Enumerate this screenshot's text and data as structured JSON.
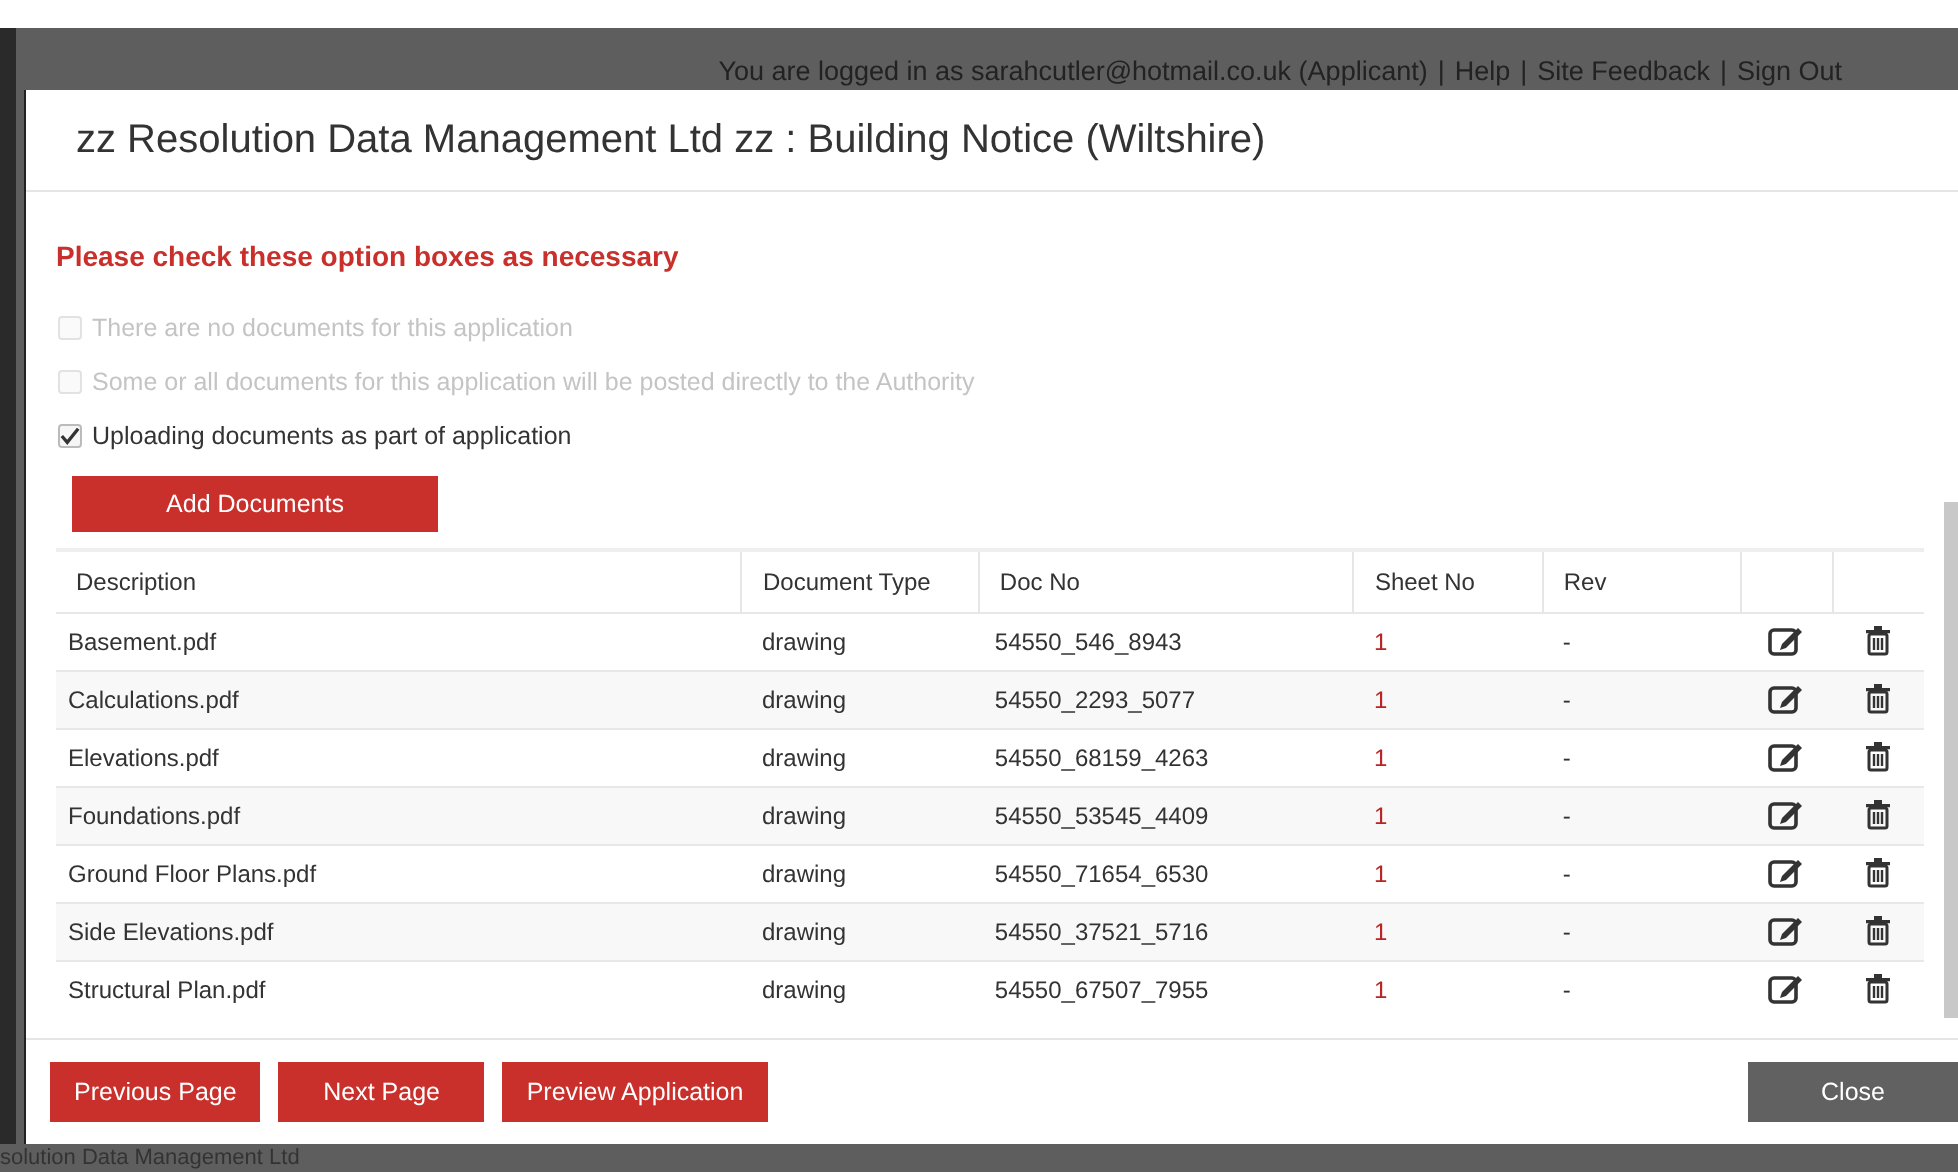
{
  "top_bar": {
    "login_text": "You are logged in as sarahcutler@hotmail.co.uk (Applicant)",
    "links": [
      {
        "separator": "|",
        "label": "Help"
      },
      {
        "separator": "|",
        "label": "Site Feedback"
      },
      {
        "separator": "|",
        "label": "Sign Out"
      }
    ]
  },
  "dialog": {
    "title": "zz Resolution Data Management Ltd zz : Building Notice (Wiltshire)",
    "heading": "Please check these option boxes as necessary",
    "options": [
      {
        "label": "There are no documents for this application",
        "checked": false,
        "disabled": true
      },
      {
        "label": "Some or all documents for this application will be posted directly to the Authority",
        "checked": false,
        "disabled": true
      },
      {
        "label": "Uploading documents as part of application",
        "checked": true,
        "disabled": false
      }
    ],
    "add_button": "Add Documents",
    "table": {
      "columns": [
        "Description",
        "Document Type",
        "Doc No",
        "Sheet No",
        "Rev"
      ],
      "rows": [
        {
          "description": "Basement.pdf",
          "document_type": "drawing",
          "doc_no": "54550_546_8943",
          "sheet_no": "1",
          "rev": "-"
        },
        {
          "description": "Calculations.pdf",
          "document_type": "drawing",
          "doc_no": "54550_2293_5077",
          "sheet_no": "1",
          "rev": "-"
        },
        {
          "description": "Elevations.pdf",
          "document_type": "drawing",
          "doc_no": "54550_68159_4263",
          "sheet_no": "1",
          "rev": "-"
        },
        {
          "description": "Foundations.pdf",
          "document_type": "drawing",
          "doc_no": "54550_53545_4409",
          "sheet_no": "1",
          "rev": "-"
        },
        {
          "description": "Ground Floor Plans.pdf",
          "document_type": "drawing",
          "doc_no": "54550_71654_6530",
          "sheet_no": "1",
          "rev": "-"
        },
        {
          "description": "Side Elevations.pdf",
          "document_type": "drawing",
          "doc_no": "54550_37521_5716",
          "sheet_no": "1",
          "rev": "-"
        },
        {
          "description": "Structural Plan.pdf",
          "document_type": "drawing",
          "doc_no": "54550_67507_7955",
          "sheet_no": "1",
          "rev": "-"
        }
      ]
    },
    "footer_buttons": [
      {
        "label": "Previous Page",
        "kind": "primary"
      },
      {
        "label": "Next Page",
        "kind": "primary"
      },
      {
        "label": "Preview Application",
        "kind": "primary"
      },
      {
        "label": "Close",
        "kind": "secondary"
      }
    ]
  },
  "page_footer": "solution Data Management Ltd"
}
